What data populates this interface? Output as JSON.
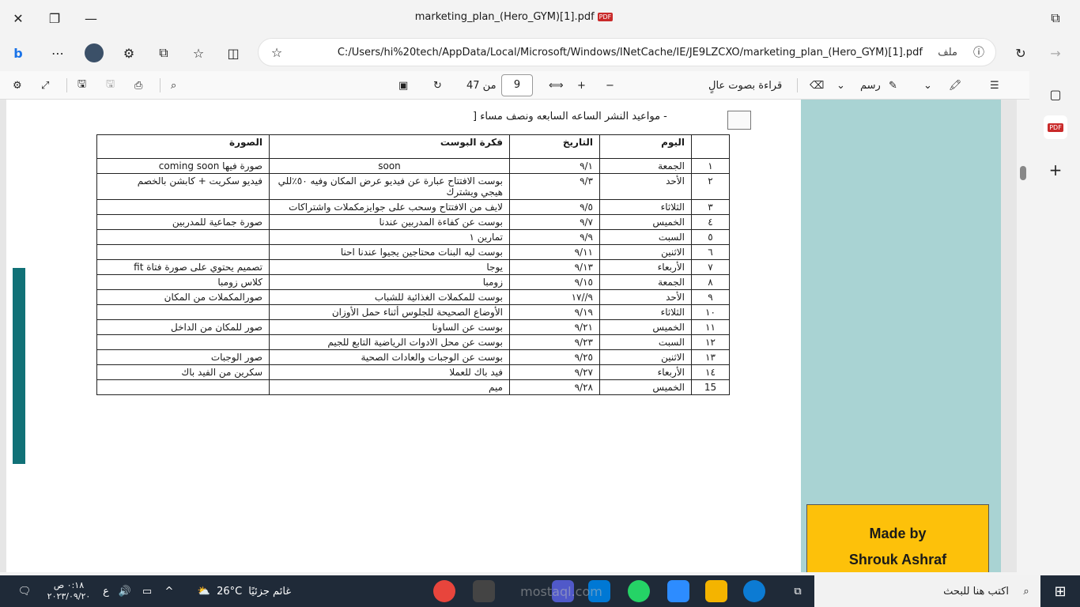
{
  "titlebar": {
    "title": "marketing_plan_(Hero_GYM)[1].pdf",
    "pdf_badge": "PDF"
  },
  "address": {
    "url": "C:/Users/hi%20tech/AppData/Local/Microsoft/Windows/INetCache/IE/JE9LZCXO/marketing_plan_(Hero_GYM)[1].pdf",
    "file_label": "ملف"
  },
  "pdf_toolbar": {
    "page_current": "9",
    "page_of": "من 47",
    "read_aloud": "قراءة بصوت عالٍ",
    "draw": "رسم"
  },
  "doc": {
    "heading": "-   مواعيد النشر الساعه السابعه ونصف مساء [",
    "headers": [
      "",
      "اليوم",
      "التاريخ",
      "فكرة البوست",
      "الصورة"
    ],
    "rows": [
      [
        "١",
        "الجمعة",
        "٩/١",
        "soon",
        "صورة فيها  coming soon"
      ],
      [
        "٢",
        "الأحد",
        "٩/٣",
        "بوست الافتتاح عبارة عن فيديو عرض المكان وفيه ٥٠٪للي هيجي ويشترك",
        "فيديو سكريت + كابشن بالخصم"
      ],
      [
        "٣",
        "الثلاثاء",
        "٩/٥",
        "لايف من الافتتاح وسحب على جوايزمكملات واشتراكات",
        ""
      ],
      [
        "٤",
        "الخميس",
        "٩/٧",
        "بوست عن كفاءة المدربين عندنا",
        "صورة جماعية للمدربين"
      ],
      [
        "٥",
        "السبت",
        "٩/٩",
        "تمارين ١",
        ""
      ],
      [
        "٦",
        "الاثنين",
        "٩/١١",
        "بوست ليه البنات محتاجين يجيوا عندنا احنا",
        ""
      ],
      [
        "٧",
        "الأربعاء",
        "٩/١٣",
        "يوجا",
        "تصميم يحتوي على صورة فتاة fit"
      ],
      [
        "٨",
        "الجمعة",
        "٩/١٥",
        "زومبا",
        "كلاس زومبا"
      ],
      [
        "٩",
        "الأحد",
        "٩//١٧",
        "بوست للمكملات الغذائية للشباب",
        "صورالمكملات من المكان"
      ],
      [
        "١٠",
        "الثلاثاء",
        "٩/١٩",
        "الأوضاع الصحيحة للجلوس أثناء حمل الأوزان",
        ""
      ],
      [
        "١١",
        "الخميس",
        "٩/٢١",
        "بوست عن الساونا",
        "صور للمكان من الداخل"
      ],
      [
        "١٢",
        "السبت",
        "٩/٢٣",
        "بوست عن محل الادوات الرياضية التابع للجيم",
        ""
      ],
      [
        "١٣",
        "الاثنين",
        "٩/٢٥",
        "بوست عن الوجبات والعادات الصحية",
        "صور الوجبات"
      ],
      [
        "١٤",
        "الأربعاء",
        "٩/٢٧",
        "فيد باك للعملا",
        "سكرين من الفيد باك"
      ],
      [
        "15",
        "الخميس",
        "٩/٢٨",
        "ميم",
        ""
      ]
    ],
    "made_by_line1": "Made by",
    "made_by_line2": "Shrouk Ashraf"
  },
  "taskbar": {
    "search_placeholder": "اكتب هنا للبحث",
    "weather_temp": "26°C",
    "weather_text": "غائم جزئيًا",
    "time": "٠:١٨ ص",
    "date": "٢٠٢٣/٠٩/٢٠",
    "lang": "ع",
    "watermark": "mostaql.com"
  }
}
